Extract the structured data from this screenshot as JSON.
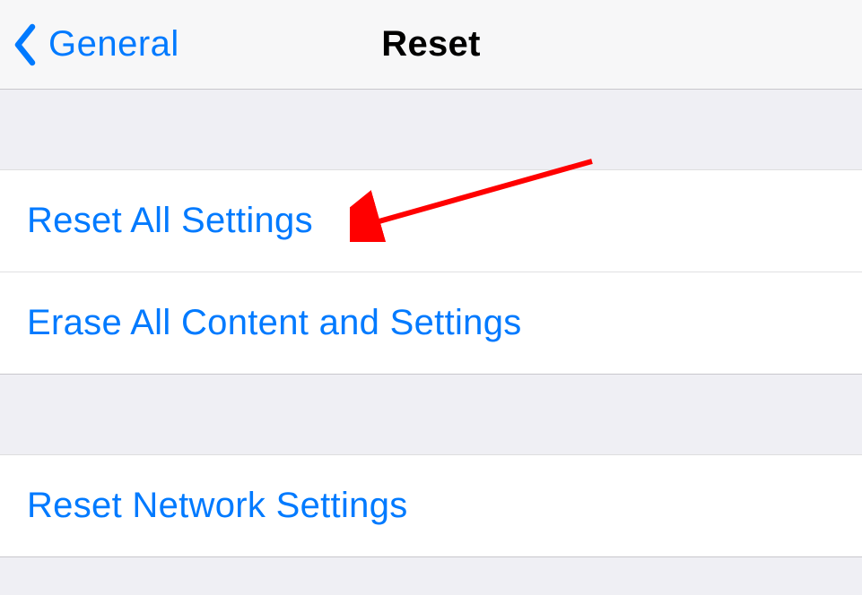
{
  "nav": {
    "back_label": "General",
    "title": "Reset"
  },
  "sections": [
    {
      "items": [
        {
          "label": "Reset All Settings"
        },
        {
          "label": "Erase All Content and Settings"
        }
      ]
    },
    {
      "items": [
        {
          "label": "Reset Network Settings"
        }
      ]
    }
  ],
  "colors": {
    "ios_blue": "#007aff",
    "arrow_red": "#ff0000"
  }
}
